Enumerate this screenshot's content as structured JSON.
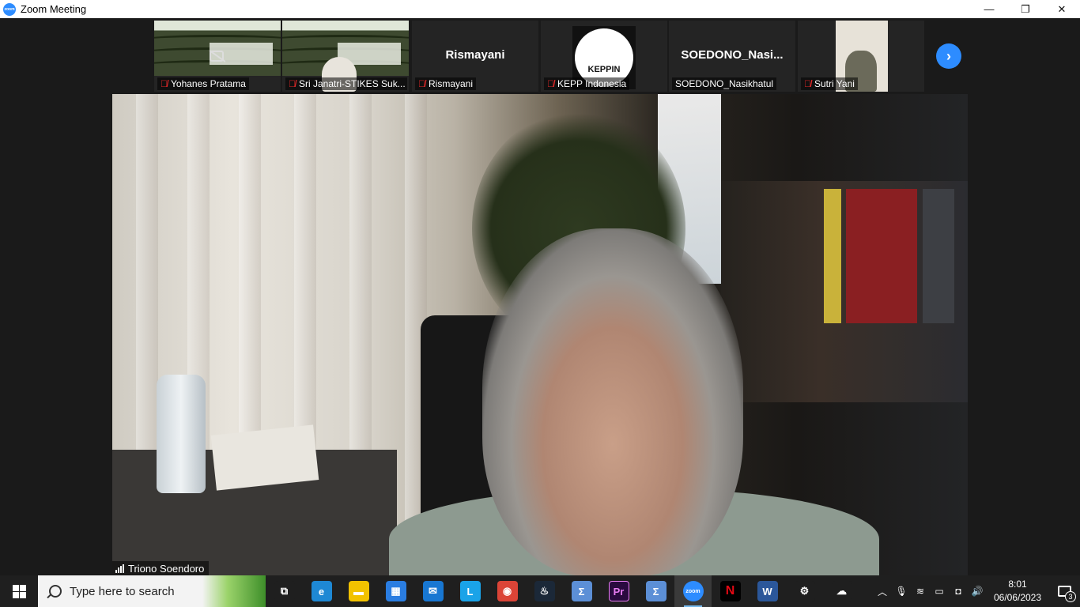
{
  "window": {
    "title": "Zoom Meeting",
    "app_icon": "zoom-icon",
    "minimize": "—",
    "restore": "❐",
    "close": "✕"
  },
  "gallery": {
    "tiles": [
      {
        "name": "Yohanes Pratama",
        "muted": true,
        "video": "slide-camera-off"
      },
      {
        "name": "Sri Janatri-STIKES Suk...",
        "muted": true,
        "video": "slide-person"
      },
      {
        "name": "Rismayani",
        "muted": true,
        "display_name": "Rismayani",
        "video": "none"
      },
      {
        "name": "KEPP Indonesia",
        "muted": true,
        "video": "logo",
        "logo_text": "KEPPIN"
      },
      {
        "name": "SOEDONO_Nasikhatul",
        "muted": false,
        "display_name": "SOEDONO_Nasi...",
        "video": "none"
      },
      {
        "name": "Sutri Yani",
        "muted": true,
        "video": "photo"
      }
    ],
    "next_icon": "chevron-right-icon",
    "next_glyph": "›"
  },
  "speaker": {
    "name": "Triono Soendoro",
    "signal_icon": "signal-bars-icon"
  },
  "taskbar": {
    "search_placeholder": "Type here to search",
    "apps": [
      {
        "name": "task-view",
        "glyph": "⧉",
        "color": "#1f1f1f"
      },
      {
        "name": "edge",
        "glyph": "e",
        "color": "#1e88d4"
      },
      {
        "name": "file-explorer",
        "glyph": "▬",
        "color": "#f2c200"
      },
      {
        "name": "microsoft-store",
        "glyph": "▦",
        "color": "#2a7de1"
      },
      {
        "name": "mail",
        "glyph": "✉",
        "color": "#1877d2"
      },
      {
        "name": "l-app",
        "glyph": "L",
        "color": "#1aa3e8"
      },
      {
        "name": "chrome",
        "glyph": "◉",
        "color": "#db4437"
      },
      {
        "name": "steam",
        "glyph": "♨",
        "color": "#1b2838"
      },
      {
        "name": "sigma-app-1",
        "glyph": "Σ",
        "color": "#5c8fd6"
      },
      {
        "name": "premiere-pro",
        "glyph": "Pr",
        "color": "#2a0a3f"
      },
      {
        "name": "sigma-app-2",
        "glyph": "Σ",
        "color": "#5c8fd6"
      },
      {
        "name": "zoom",
        "glyph": "zoom",
        "color": "#2d8cff",
        "active": true
      },
      {
        "name": "netflix",
        "glyph": "N",
        "color": "#000000"
      },
      {
        "name": "word",
        "glyph": "W",
        "color": "#2b579a"
      },
      {
        "name": "settings",
        "glyph": "⚙",
        "color": "#1f1f1f"
      },
      {
        "name": "onedrive",
        "glyph": "☁",
        "color": "#1f1f1f"
      }
    ],
    "tray": {
      "icons": [
        "chevron-up-icon",
        "microphone-icon",
        "wifi-icon",
        "battery-icon",
        "webcam-icon",
        "speaker-icon"
      ],
      "glyphs": [
        "︿",
        "🎙",
        "≋",
        "▭",
        "◘",
        "🔊"
      ],
      "time": "8:01",
      "date": "06/06/2023",
      "notification_count": "3"
    }
  }
}
